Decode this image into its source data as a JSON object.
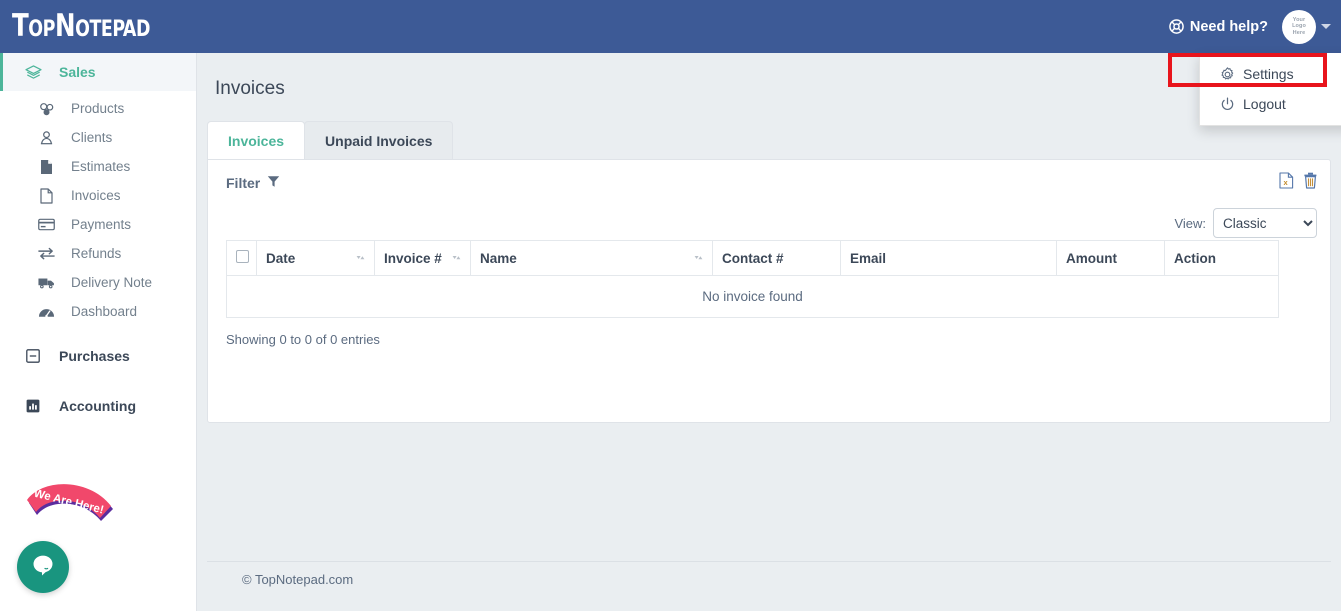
{
  "header": {
    "brand": "TopNotepad",
    "help_label": "Need help?",
    "help_icon": "lifebuoy-icon",
    "avatar_lines": [
      "Your",
      "Logo",
      "Here"
    ],
    "caret_icon": "caret-down-icon"
  },
  "user_menu": {
    "items": [
      {
        "label": "Settings",
        "icon": "gear-icon"
      },
      {
        "label": "Logout",
        "icon": "power-icon"
      }
    ]
  },
  "sidebar": {
    "groups": [
      {
        "label": "Sales",
        "icon": "layers-icon",
        "active": true,
        "items": [
          {
            "label": "Products",
            "icon": "cubes-icon"
          },
          {
            "label": "Clients",
            "icon": "user-icon"
          },
          {
            "label": "Estimates",
            "icon": "file-filled-icon"
          },
          {
            "label": "Invoices",
            "icon": "file-outline-icon"
          },
          {
            "label": "Payments",
            "icon": "credit-card-icon"
          },
          {
            "label": "Refunds",
            "icon": "exchange-icon"
          },
          {
            "label": "Delivery Note",
            "icon": "truck-icon"
          },
          {
            "label": "Dashboard",
            "icon": "tachometer-icon"
          }
        ]
      },
      {
        "label": "Purchases",
        "icon": "minus-square-icon",
        "active": false,
        "items": []
      },
      {
        "label": "Accounting",
        "icon": "bar-chart-icon",
        "active": false,
        "items": []
      }
    ]
  },
  "chat": {
    "banner": "We Are Here!",
    "button_icon": "chat-bubble-icon"
  },
  "main": {
    "page_title": "Invoices",
    "tabs": [
      {
        "label": "Invoices",
        "active": true
      },
      {
        "label": "Unpaid Invoices",
        "active": false
      }
    ],
    "filter_label": "Filter",
    "filter_icon": "funnel-icon",
    "tool_icons": [
      {
        "name": "excel-export-icon"
      },
      {
        "name": "trash-icon"
      }
    ],
    "view": {
      "label": "View:",
      "value": "Classic",
      "options": [
        "Classic"
      ]
    },
    "table": {
      "columns": [
        {
          "label": "",
          "sortable": false,
          "checkbox": true
        },
        {
          "label": "Date",
          "sortable": true
        },
        {
          "label": "Invoice #",
          "sortable": true
        },
        {
          "label": "Name",
          "sortable": true
        },
        {
          "label": "Contact #",
          "sortable": false
        },
        {
          "label": "Email",
          "sortable": false
        },
        {
          "label": "Amount",
          "sortable": false
        },
        {
          "label": "Action",
          "sortable": false
        }
      ],
      "empty_message": "No invoice found",
      "rows": []
    },
    "showing_text": "Showing 0 to 0 of 0 entries"
  },
  "footer": {
    "copyright": "© TopNotepad.com"
  },
  "annotation": {
    "highlight_target": "Settings",
    "color": "#e8141c"
  },
  "colors": {
    "header_bg": "#3d5a96",
    "accent_green": "#4cb59a",
    "page_bg": "#eaeef1",
    "sidebar_bg": "#ffffff",
    "text_dark": "#3c4858",
    "text_muted": "#73808d",
    "chat_teal": "#19957f",
    "banner_pink": "#f1486b"
  }
}
